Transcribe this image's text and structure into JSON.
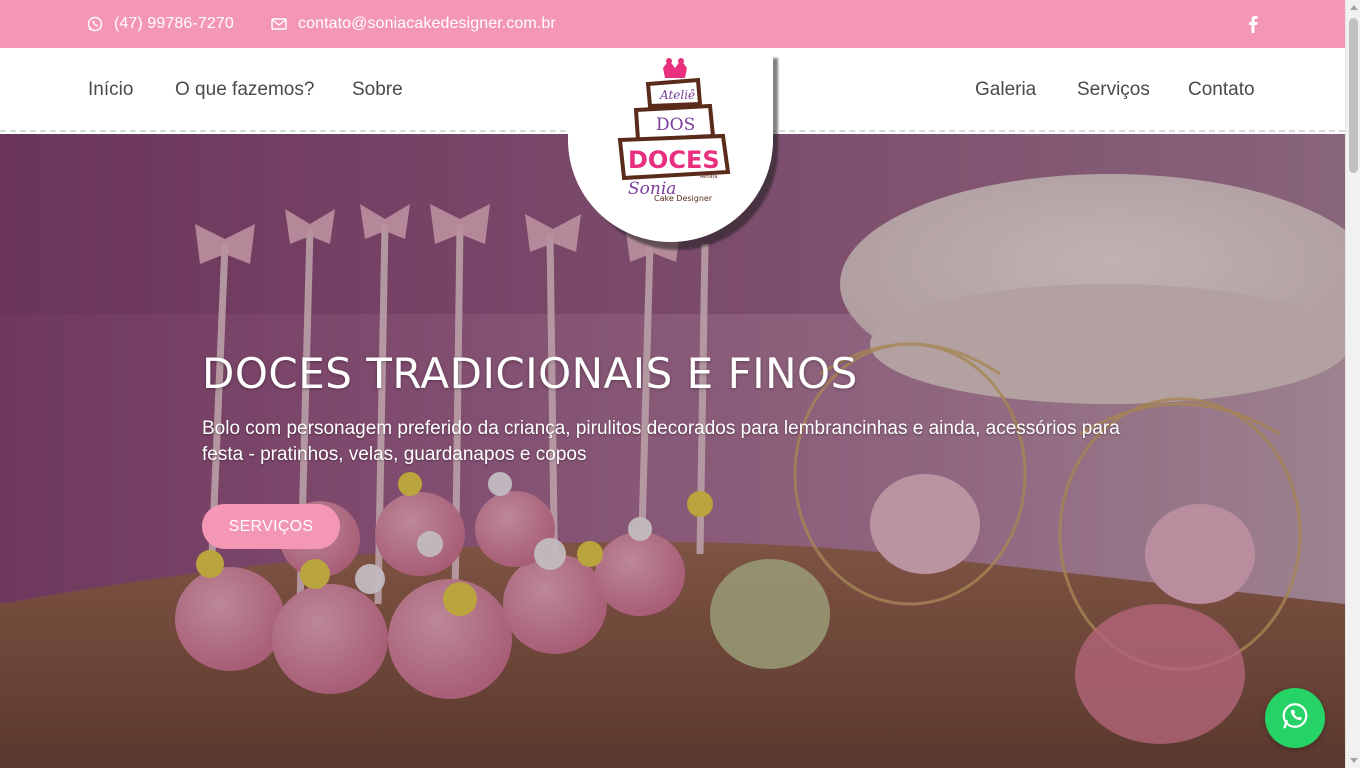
{
  "topbar": {
    "phone": "(47) 99786-7270",
    "email": "contato@soniacakedesigner.com.br",
    "phone_icon": "whatsapp-icon",
    "email_icon": "envelope-icon",
    "social_icon": "facebook-icon"
  },
  "nav": {
    "left": [
      {
        "label": "Início"
      },
      {
        "label": "O que fazemos?"
      },
      {
        "label": "Sobre"
      }
    ],
    "right": [
      {
        "label": "Galeria"
      },
      {
        "label": "Serviços"
      },
      {
        "label": "Contato"
      }
    ]
  },
  "logo": {
    "line1": "Ateliê",
    "line2": "DOS",
    "line3": "DOCES",
    "line4": "Sonia",
    "line5": "Cake Designer",
    "tag": "Renata"
  },
  "hero": {
    "title": "DOCES TRADICIONAIS E FINOS",
    "text": "Bolo com personagem preferido da criança, pirulitos decorados para lembrancinhas e ainda, acessórios para festa - pratinhos, velas, guardanapos e copos",
    "button": "SERVIÇOS"
  },
  "colors": {
    "brand_pink": "#f497b4",
    "whatsapp_green": "#25d366",
    "nav_text": "#4a4a4a"
  }
}
